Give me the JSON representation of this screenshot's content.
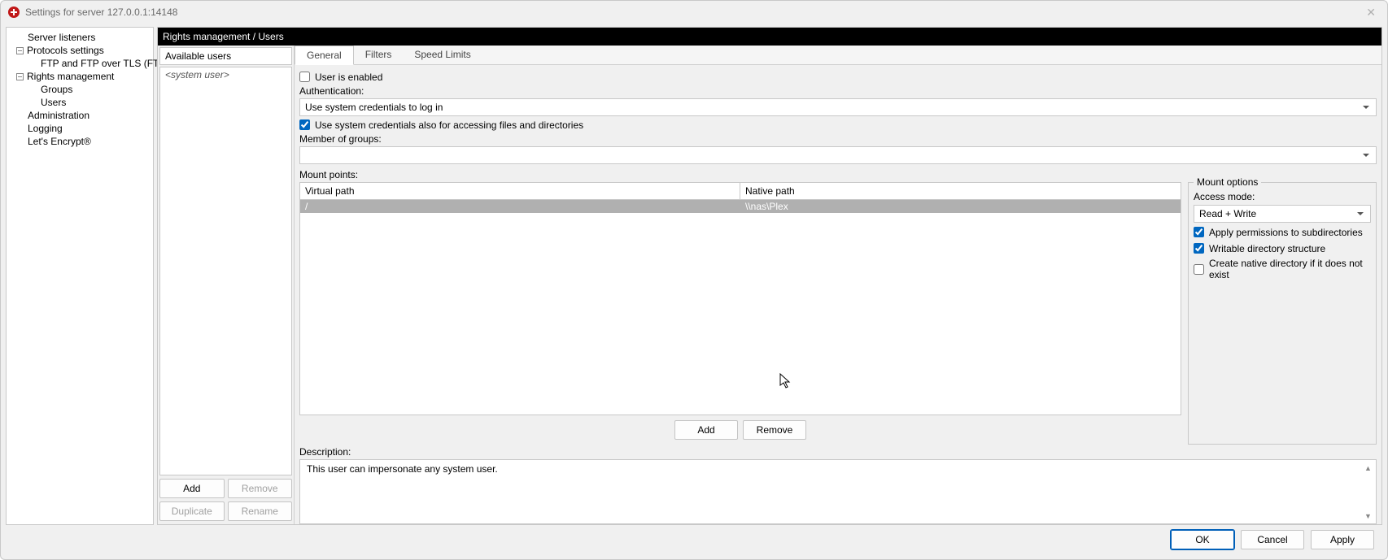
{
  "window": {
    "title": "Settings for server 127.0.0.1:14148"
  },
  "nav": {
    "server_listeners": "Server listeners",
    "protocols_settings": "Protocols settings",
    "ftp_ftps": "FTP and FTP over TLS (FTPS)",
    "rights_management": "Rights management",
    "groups": "Groups",
    "users": "Users",
    "administration": "Administration",
    "logging": "Logging",
    "lets_encrypt": "Let's Encrypt®"
  },
  "breadcrumb": "Rights management / Users",
  "userlist": {
    "header": "Available users",
    "system_user": "<system user>",
    "add": "Add",
    "remove": "Remove",
    "duplicate": "Duplicate",
    "rename": "Rename"
  },
  "tabs": {
    "general": "General",
    "filters": "Filters",
    "speed_limits": "Speed Limits"
  },
  "form": {
    "user_enabled": "User is enabled",
    "auth_label": "Authentication:",
    "auth_value": "Use system credentials to log in",
    "use_sys_files": "Use system credentials also for accessing files and directories",
    "member_label": "Member of groups:",
    "member_value": "",
    "mount_label": "Mount points:",
    "col_virtual": "Virtual path",
    "col_native": "Native path",
    "row0_virtual": "/",
    "row0_native": "\\\\nas\\Plex",
    "opt_legend": "Mount options",
    "access_mode_label": "Access mode:",
    "access_mode_value": "Read + Write",
    "apply_perms": "Apply permissions to subdirectories",
    "writable_dir": "Writable directory structure",
    "create_native": "Create native directory if it does not exist",
    "mount_add": "Add",
    "mount_remove": "Remove",
    "desc_label": "Description:",
    "desc_value": "This user can impersonate any system user."
  },
  "footer": {
    "ok": "OK",
    "cancel": "Cancel",
    "apply": "Apply"
  }
}
